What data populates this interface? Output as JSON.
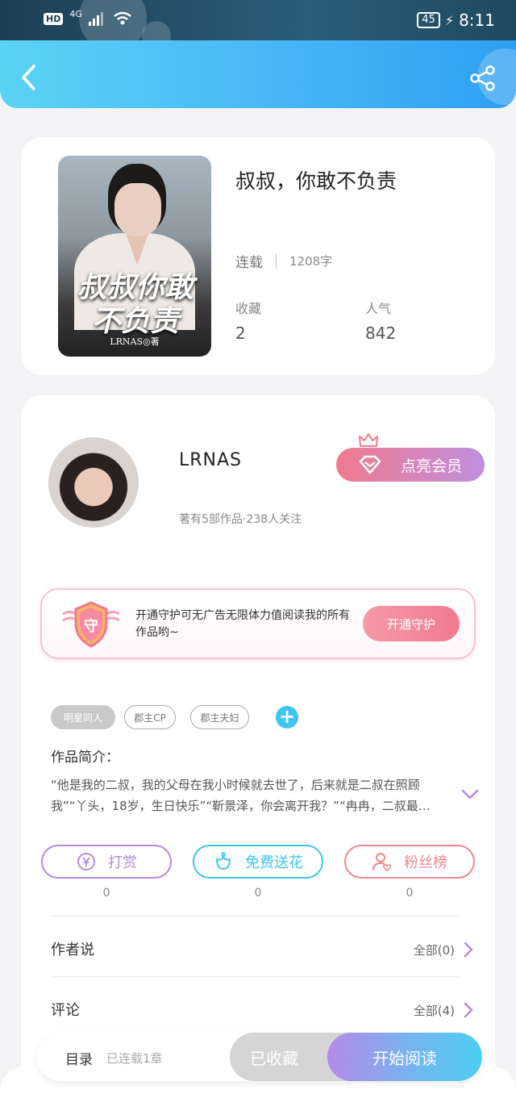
{
  "status_bar": {
    "hd": "HD",
    "network": "4G",
    "battery": "45",
    "time": "8:11"
  },
  "book": {
    "title": "叔叔，你敢不负责",
    "cover_title": "叔叔你敢不负责",
    "cover_author": "LRNAS◎著",
    "status": "连载",
    "word_count": "1208字",
    "stats": [
      {
        "label": "收藏",
        "value": "2"
      },
      {
        "label": "人气",
        "value": "842"
      }
    ]
  },
  "author": {
    "name": "LRNAS",
    "meta": "著有5部作品·238人关注",
    "vip_label": "点亮会员"
  },
  "guard": {
    "shield_char": "守",
    "text": "开通守护可无广告无限体力值阅读我的所有作品哟~",
    "button": "开通守护"
  },
  "tags": [
    "明星同人",
    "郡主CP",
    "郡主夫妇"
  ],
  "intro": {
    "label": "作品简介：",
    "text": "“他是我的二叔，我的父母在我小时候就去世了，后来就是二叔在照顾我”“丫头，18岁，生日快乐”“靳景泽，你会离开我？”“冉冉，二叔最…"
  },
  "actions": [
    {
      "label": "打赏",
      "count": "0",
      "color": "#b48ae0",
      "icon": "yen-coin-icon"
    },
    {
      "label": "免费送花",
      "count": "0",
      "color": "#3fc6ee",
      "icon": "flower-icon"
    },
    {
      "label": "粉丝榜",
      "count": "0",
      "color": "#ef8790",
      "icon": "fan-user-heart-icon"
    }
  ],
  "rows": [
    {
      "label": "作者说",
      "more": "全部(0)"
    },
    {
      "label": "评论",
      "more": "全部(4)"
    }
  ],
  "bottom": {
    "toc": "目录",
    "toc_sub": "已连载1章",
    "collected": "已收藏",
    "read": "开始阅读"
  },
  "colors": {
    "accent_blue": "#3fc6ee",
    "accent_purple": "#b48ae0",
    "accent_pink": "#ef8790"
  }
}
